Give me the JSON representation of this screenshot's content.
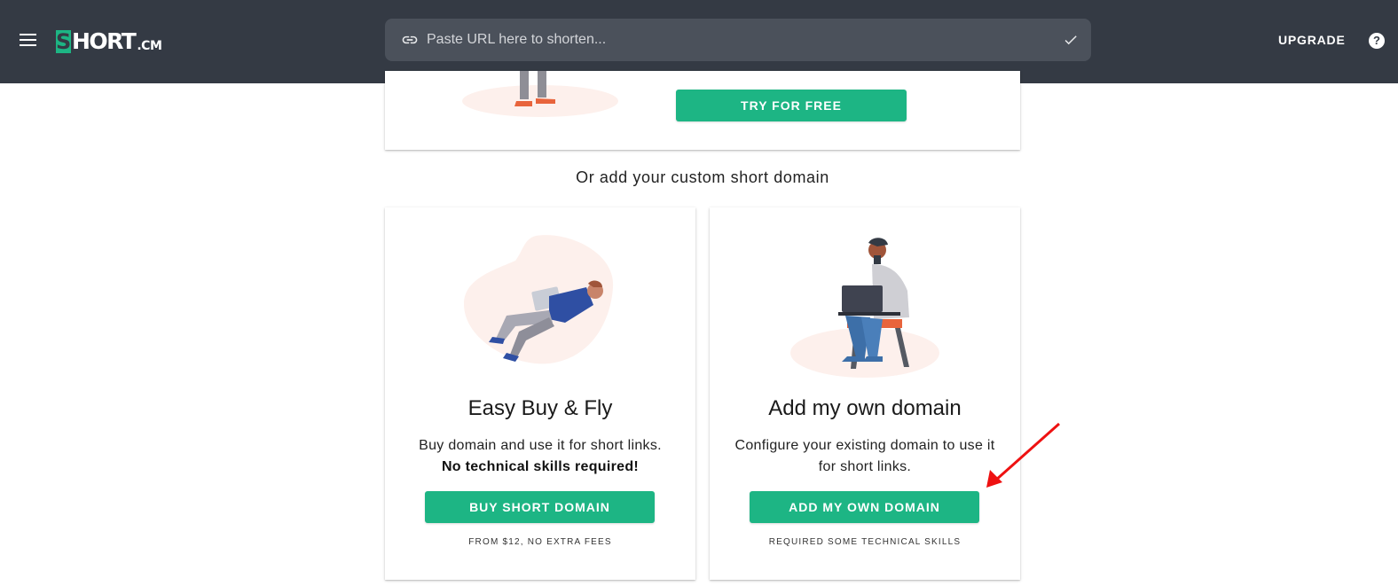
{
  "header": {
    "logo": {
      "s": "S",
      "text": "HORT",
      "suffix": ".CM"
    },
    "search_placeholder": "Paste URL here to shorten...",
    "upgrade_label": "UPGRADE",
    "help_label": "?"
  },
  "top_card": {
    "try_label": "TRY FOR FREE"
  },
  "or_text": "Or add your custom short domain",
  "cards": [
    {
      "title": "Easy Buy & Fly",
      "desc_line1": "Buy domain and use it for short links.",
      "desc_bold": "No technical skills required!",
      "button": "BUY SHORT DOMAIN",
      "note": "FROM $12, NO EXTRA FEES"
    },
    {
      "title": "Add my own domain",
      "desc_line1": "Configure your existing domain to use it for short links.",
      "button": "ADD MY OWN DOMAIN",
      "note": "REQUIRED SOME TECHNICAL SKILLS"
    }
  ],
  "colors": {
    "header_bg": "#343a44",
    "search_bg": "#4b515b",
    "accent": "#1db584",
    "annotation_arrow": "#ee1111"
  },
  "icons": {
    "menu": "hamburger-menu-icon",
    "link": "link-icon",
    "check": "check-icon",
    "help": "help-icon"
  }
}
